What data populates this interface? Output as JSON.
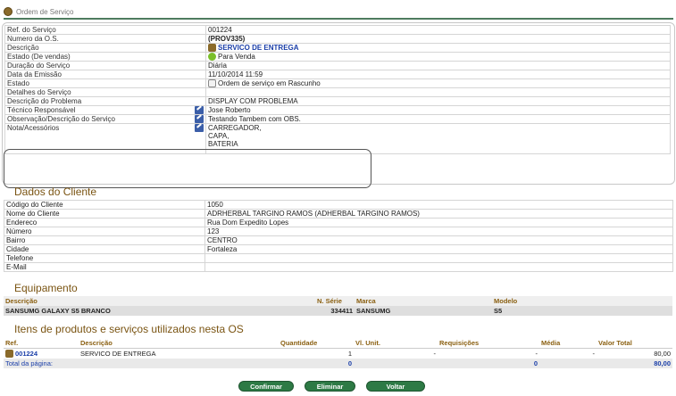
{
  "header": {
    "title": "Ordem de Serviço"
  },
  "os": {
    "ref_label": "Ref. do Serviço",
    "ref": "001224",
    "numero_label": "Numero da O.S.",
    "numero": "(PROV335)",
    "descricao_label": "Descrição",
    "descricao": "SERVICO DE ENTREGA",
    "estado_vendas_label": "Estado (De vendas)",
    "estado_vendas": "Para Venda",
    "duracao_label": "Duração do Serviço",
    "duracao": "Diária",
    "data_label": "Data da Emissão",
    "data": "11/10/2014 11:59",
    "estado_label": "Estado",
    "estado": "Ordem de serviço em Rascunho",
    "detalhes_label": "Detalhes do Serviço",
    "detalhes": "",
    "problema_label": "Descrição do Problema",
    "problema": "DISPLAY COM PROBLEMA",
    "tecnico_label": "Técnico Responsável",
    "tecnico": "Jose Roberto",
    "obs_label": "Observação/Descrição do Serviço",
    "obs": "Testando Tambem com OBS.",
    "nota_label": "Nota/Acessórios",
    "nota_lines": [
      "CARREGADOR,",
      "CAPA,",
      "BATERIA"
    ]
  },
  "cliente": {
    "title": "Dados do Cliente",
    "rows": [
      {
        "label": "Código do Cliente",
        "value": "1050"
      },
      {
        "label": "Nome do Cliente",
        "value": "ADRHERBAL TARGINO RAMOS (ADHERBAL TARGINO RAMOS)"
      },
      {
        "label": "Endereco",
        "value": "Rua Dom Expedito Lopes"
      },
      {
        "label": "Número",
        "value": "123"
      },
      {
        "label": "Bairro",
        "value": "CENTRO"
      },
      {
        "label": "Cidade",
        "value": "Fortaleza"
      },
      {
        "label": "Telefone",
        "value": ""
      },
      {
        "label": "E-Mail",
        "value": ""
      }
    ]
  },
  "equip": {
    "title": "Equipamento",
    "h_desc": "Descrição",
    "h_serie": "N. Série",
    "h_marca": "Marca",
    "h_modelo": "Modelo",
    "desc": "SANSUMG GALAXY S5 BRANCO",
    "serie": "334411",
    "marca": "SANSUMG",
    "modelo": "S5"
  },
  "itens": {
    "title": "Itens de produtos e serviços utilizados nesta OS",
    "h_ref": "Ref.",
    "h_desc": "Descrição",
    "h_qtd": "Quantidade",
    "h_unit": "Vl. Unit.",
    "h_req": "Requisições",
    "h_media": "Média",
    "h_total": "Valor Total",
    "row": {
      "ref": "001224",
      "desc": "SERVICO DE ENTREGA",
      "qtd": "1",
      "unit": "-",
      "req": "-",
      "media": "-",
      "total": "80,00"
    },
    "total_label": "Total da página:",
    "total_qtd": "0",
    "total_req": "0",
    "total_valor": "80,00"
  },
  "buttons": {
    "confirm": "Confirmar",
    "delete": "Eliminar",
    "back": "Voltar"
  }
}
